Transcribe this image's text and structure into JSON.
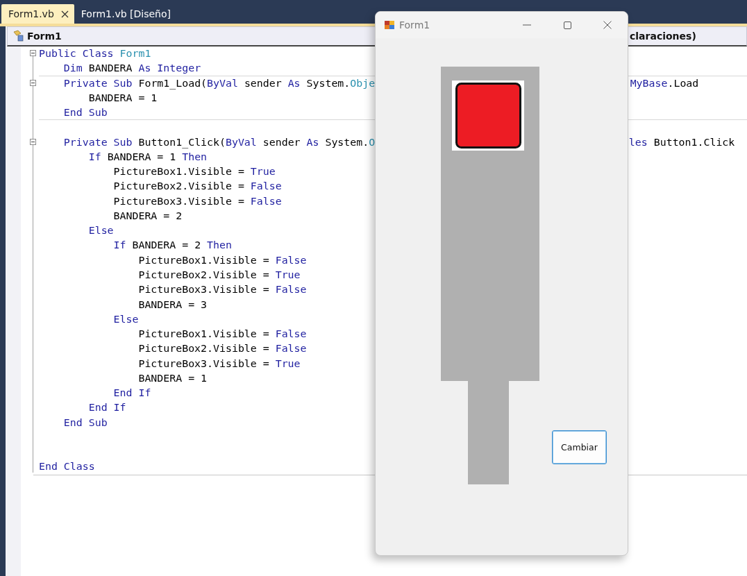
{
  "tabs": [
    {
      "label": "Form1.vb",
      "selected": true,
      "closable": true
    },
    {
      "label": "Form1.vb [Diseño]",
      "selected": false,
      "closable": false
    }
  ],
  "navigation_bar": {
    "class_combo": "Form1",
    "member_combo": "claraciones)"
  },
  "code_lines": [
    {
      "fold": true,
      "tokens": [
        {
          "kind": "kw",
          "t": "Public Class "
        },
        {
          "kind": "type",
          "t": "Form1"
        }
      ]
    },
    {
      "fold": false,
      "tokens": [
        {
          "kind": "kw",
          "t": "    Dim "
        },
        {
          "kind": "plain",
          "t": "BANDERA "
        },
        {
          "kind": "kw",
          "t": "As Integer"
        }
      ]
    },
    {
      "fold": true,
      "tokens": [
        {
          "kind": "kw",
          "t": "    Private Sub "
        },
        {
          "kind": "plain",
          "t": "Form1_Load("
        },
        {
          "kind": "kw",
          "t": "ByVal "
        },
        {
          "kind": "plain",
          "t": "sender "
        },
        {
          "kind": "kw",
          "t": "As "
        },
        {
          "kind": "plain",
          "t": "System."
        },
        {
          "kind": "type",
          "t": "Obje"
        }
      ],
      "right_tokens": [
        {
          "kind": "kw",
          "t": "MyBase"
        },
        {
          "kind": "plain",
          "t": ".Load"
        }
      ]
    },
    {
      "fold": false,
      "tokens": [
        {
          "kind": "plain",
          "t": "        BANDERA = 1"
        }
      ]
    },
    {
      "fold": false,
      "tokens": [
        {
          "kind": "kw",
          "t": "    End Sub"
        }
      ]
    },
    {
      "fold": false
    },
    {
      "fold": true,
      "tokens": [
        {
          "kind": "kw",
          "t": "    Private Sub "
        },
        {
          "kind": "plain",
          "t": "Button1_Click("
        },
        {
          "kind": "kw",
          "t": "ByVal "
        },
        {
          "kind": "plain",
          "t": "sender "
        },
        {
          "kind": "kw",
          "t": "As "
        },
        {
          "kind": "plain",
          "t": "System."
        },
        {
          "kind": "type",
          "t": "O"
        }
      ],
      "right_tokens": [
        {
          "kind": "kw",
          "t": "les "
        },
        {
          "kind": "plain",
          "t": "Button1.Click"
        }
      ]
    },
    {
      "fold": false,
      "tokens": [
        {
          "kind": "kw",
          "t": "        If "
        },
        {
          "kind": "plain",
          "t": "BANDERA = 1 "
        },
        {
          "kind": "kw",
          "t": "Then"
        }
      ]
    },
    {
      "fold": false,
      "tokens": [
        {
          "kind": "plain",
          "t": "            PictureBox1.Visible = "
        },
        {
          "kind": "kw",
          "t": "True"
        }
      ]
    },
    {
      "fold": false,
      "tokens": [
        {
          "kind": "plain",
          "t": "            PictureBox2.Visible = "
        },
        {
          "kind": "kw",
          "t": "False"
        }
      ]
    },
    {
      "fold": false,
      "tokens": [
        {
          "kind": "plain",
          "t": "            PictureBox3.Visible = "
        },
        {
          "kind": "kw",
          "t": "False"
        }
      ]
    },
    {
      "fold": false,
      "tokens": [
        {
          "kind": "plain",
          "t": "            BANDERA = 2"
        }
      ]
    },
    {
      "fold": false,
      "tokens": [
        {
          "kind": "kw",
          "t": "        Else"
        }
      ]
    },
    {
      "fold": false,
      "tokens": [
        {
          "kind": "kw",
          "t": "            If "
        },
        {
          "kind": "plain",
          "t": "BANDERA = 2 "
        },
        {
          "kind": "kw",
          "t": "Then"
        }
      ]
    },
    {
      "fold": false,
      "tokens": [
        {
          "kind": "plain",
          "t": "                PictureBox1.Visible = "
        },
        {
          "kind": "kw",
          "t": "False"
        }
      ]
    },
    {
      "fold": false,
      "tokens": [
        {
          "kind": "plain",
          "t": "                PictureBox2.Visible = "
        },
        {
          "kind": "kw",
          "t": "True"
        }
      ]
    },
    {
      "fold": false,
      "tokens": [
        {
          "kind": "plain",
          "t": "                PictureBox3.Visible = "
        },
        {
          "kind": "kw",
          "t": "False"
        }
      ]
    },
    {
      "fold": false,
      "tokens": [
        {
          "kind": "plain",
          "t": "                BANDERA = 3"
        }
      ]
    },
    {
      "fold": false,
      "tokens": [
        {
          "kind": "kw",
          "t": "            Else"
        }
      ]
    },
    {
      "fold": false,
      "tokens": [
        {
          "kind": "plain",
          "t": "                PictureBox1.Visible = "
        },
        {
          "kind": "kw",
          "t": "False"
        }
      ]
    },
    {
      "fold": false,
      "tokens": [
        {
          "kind": "plain",
          "t": "                PictureBox2.Visible = "
        },
        {
          "kind": "kw",
          "t": "False"
        }
      ]
    },
    {
      "fold": false,
      "tokens": [
        {
          "kind": "plain",
          "t": "                PictureBox3.Visible = "
        },
        {
          "kind": "kw",
          "t": "True"
        }
      ]
    },
    {
      "fold": false,
      "tokens": [
        {
          "kind": "plain",
          "t": "                BANDERA = 1"
        }
      ]
    },
    {
      "fold": false,
      "tokens": [
        {
          "kind": "kw",
          "t": "            End If"
        }
      ]
    },
    {
      "fold": false,
      "tokens": [
        {
          "kind": "kw",
          "t": "        End If"
        }
      ]
    },
    {
      "fold": false,
      "tokens": [
        {
          "kind": "kw",
          "t": "    End Sub"
        }
      ]
    },
    {
      "fold": false
    },
    {
      "fold": false
    },
    {
      "fold": false,
      "tokens": [
        {
          "kind": "kw",
          "t": "End Class"
        }
      ]
    }
  ],
  "form_window": {
    "title": "Form1",
    "button": "Cambiar"
  }
}
